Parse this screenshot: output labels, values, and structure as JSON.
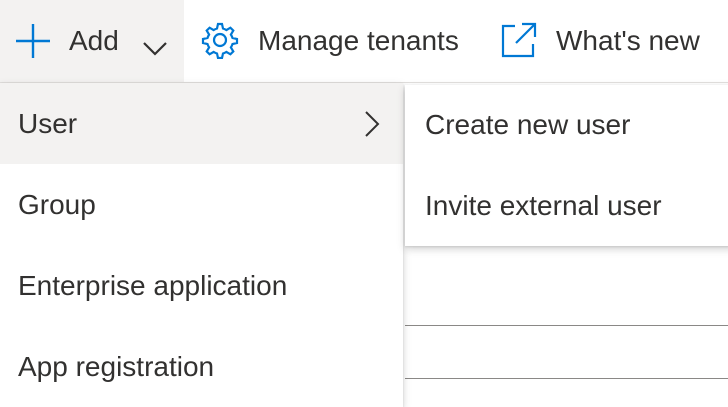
{
  "toolbar": {
    "add_label": "Add",
    "manage_tenants_label": "Manage tenants",
    "whats_new_label": "What's new"
  },
  "menu": {
    "items": [
      {
        "label": "User",
        "has_submenu": true,
        "active": true
      },
      {
        "label": "Group"
      },
      {
        "label": "Enterprise application"
      },
      {
        "label": "App registration"
      }
    ]
  },
  "submenu": {
    "items": [
      {
        "label": "Create new user"
      },
      {
        "label": "Invite external user"
      }
    ]
  },
  "colors": {
    "accent": "#0078d4",
    "text": "#323130",
    "hover_bg": "#f3f2f1",
    "divider": "#8a8886"
  },
  "icons": {
    "add": "plus-icon",
    "add_dropdown": "chevron-down-icon",
    "manage_tenants": "gear-icon",
    "whats_new": "external-link-icon",
    "submenu": "chevron-right-icon"
  }
}
